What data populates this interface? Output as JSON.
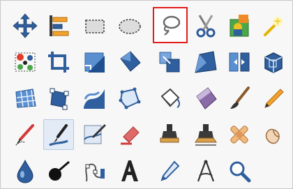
{
  "toolbox": {
    "title": "",
    "highlight_color": "#e21b1b",
    "rows": [
      [
        {
          "name": "move-tool",
          "icon": "move-icon",
          "state": "normal"
        },
        {
          "name": "align-tool",
          "icon": "align-icon",
          "state": "normal"
        },
        {
          "name": "rect-select-tool",
          "icon": "rectangle-select-icon",
          "state": "normal"
        },
        {
          "name": "ellipse-select-tool",
          "icon": "ellipse-select-icon",
          "state": "normal"
        },
        {
          "name": "free-select-tool",
          "icon": "lasso-icon",
          "state": "highlighted"
        },
        {
          "name": "scissors-select-tool",
          "icon": "scissors-icon",
          "state": "normal"
        },
        {
          "name": "foreground-select-tool",
          "icon": "foreground-select-icon",
          "state": "normal"
        },
        {
          "name": "fuzzy-select-tool",
          "icon": "magic-wand-icon",
          "state": "normal"
        }
      ],
      [
        {
          "name": "select-by-color-tool",
          "icon": "color-select-icon",
          "state": "normal"
        },
        {
          "name": "crop-tool",
          "icon": "crop-icon",
          "state": "normal"
        },
        {
          "name": "rotate-tool",
          "icon": "rotate-icon",
          "state": "normal"
        },
        {
          "name": "scale-tool",
          "icon": "scale-icon",
          "state": "normal"
        },
        {
          "name": "shear-tool",
          "icon": "shear-icon",
          "state": "normal"
        },
        {
          "name": "perspective-tool",
          "icon": "perspective-icon",
          "state": "normal"
        },
        {
          "name": "flip-tool",
          "icon": "flip-icon",
          "state": "normal"
        },
        {
          "name": "3d-transform-tool",
          "icon": "cube-icon",
          "state": "normal"
        }
      ],
      [
        {
          "name": "unified-transform-tool",
          "icon": "grid-icon",
          "state": "normal"
        },
        {
          "name": "handle-transform-tool",
          "icon": "handle-transform-icon",
          "state": "normal"
        },
        {
          "name": "warp-transform-tool",
          "icon": "warp-icon",
          "state": "normal"
        },
        {
          "name": "cage-transform-tool",
          "icon": "cage-icon",
          "state": "normal"
        },
        {
          "name": "paths-tool",
          "icon": "bucket-icon",
          "state": "normal"
        },
        {
          "name": "gradient-tool",
          "icon": "gradient-icon",
          "state": "normal"
        },
        {
          "name": "paintbrush-tool",
          "icon": "paintbrush-icon",
          "state": "normal"
        },
        {
          "name": "pencil-tool",
          "icon": "pencil-icon",
          "state": "normal"
        }
      ],
      [
        {
          "name": "airbrush-tool",
          "icon": "airbrush-icon",
          "state": "normal"
        },
        {
          "name": "ink-tool",
          "icon": "ink-pen-icon",
          "state": "active"
        },
        {
          "name": "mypaint-brush-tool",
          "icon": "canvas-brush-icon",
          "state": "normal"
        },
        {
          "name": "eraser-tool",
          "icon": "eraser-icon",
          "state": "normal"
        },
        {
          "name": "clone-tool",
          "icon": "stamp-icon",
          "state": "normal"
        },
        {
          "name": "perspective-clone-tool",
          "icon": "perspective-stamp-icon",
          "state": "normal"
        },
        {
          "name": "heal-tool",
          "icon": "bandage-icon",
          "state": "normal"
        },
        {
          "name": "smudge-tool",
          "icon": "smudge-icon",
          "state": "normal"
        }
      ],
      [
        {
          "name": "blur-sharpen-tool",
          "icon": "drop-icon",
          "state": "normal"
        },
        {
          "name": "dodge-burn-tool",
          "icon": "dodge-burn-icon",
          "state": "normal"
        },
        {
          "name": "paths-pen-tool",
          "icon": "paths-icon",
          "state": "normal"
        },
        {
          "name": "text-tool",
          "icon": "text-icon",
          "state": "normal"
        },
        {
          "name": "color-picker-tool",
          "icon": "color-picker-icon",
          "state": "normal"
        },
        {
          "name": "measure-tool",
          "icon": "compass-icon",
          "state": "normal"
        },
        {
          "name": "zoom-tool",
          "icon": "magnifier-icon",
          "state": "normal"
        }
      ]
    ]
  }
}
